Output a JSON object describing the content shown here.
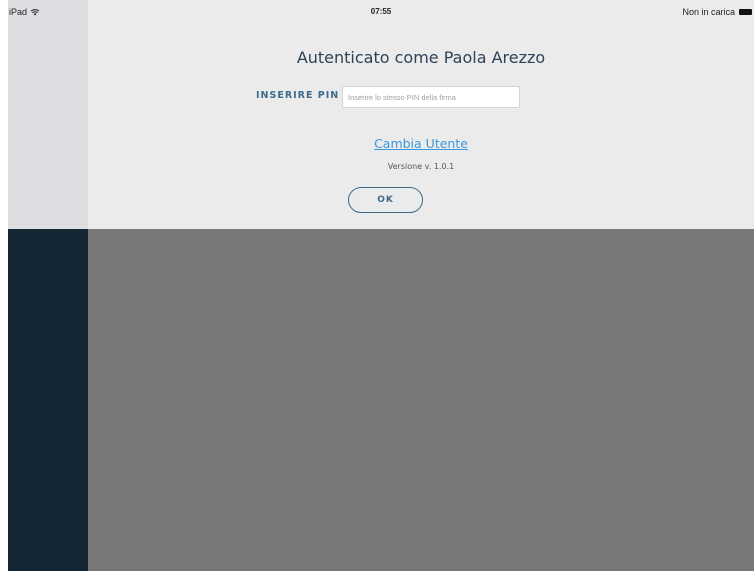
{
  "status_bar": {
    "device": "iPad",
    "time": "07:55",
    "battery_text": "Non in carica",
    "icons": [
      "wifi-icon",
      "battery-icon"
    ]
  },
  "login": {
    "title": "Autenticato come Paola Arezzo",
    "pin_label": "INSERIRE PIN",
    "pin_value": "",
    "pin_placeholder": "Inserire lo stesso PIN della firma",
    "change_user_label": "Cambia Utente",
    "version": "Versione v. 1.0.1",
    "ok_label": "OK"
  },
  "colors": {
    "panel_bg": "#ebebeb",
    "sidebar_dark": "#142533",
    "overlay": "#787878",
    "link": "#3a9ad9",
    "accent": "#3d6b8c",
    "title": "#2e4356"
  }
}
